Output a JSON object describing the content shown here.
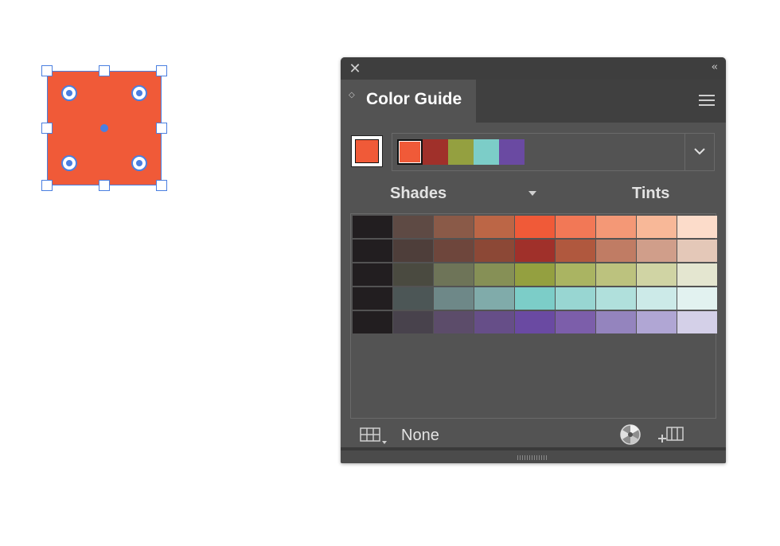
{
  "canvas": {
    "shape_fill": "#f05a38",
    "selection_color": "#4a7fe0"
  },
  "panel": {
    "title_tab": "Color Guide",
    "close_icon": "close-icon",
    "collapse_icon": "double-chevron-left-icon",
    "menu_icon": "hamburger-menu-icon",
    "base_color": "#f05a38",
    "harmony_colors": [
      "#f05a38",
      "#a0302a",
      "#94a040",
      "#7ccdc8",
      "#6a4aa2"
    ],
    "shades_label": "Shades",
    "tints_label": "Tints",
    "variation_rows": [
      [
        "#221e20",
        "#5e4a44",
        "#8a5a48",
        "#bc6646",
        "#f05a38",
        "#f27856",
        "#f49876",
        "#f8b898",
        "#fcdcca"
      ],
      [
        "#221e20",
        "#4e3e3a",
        "#6e463c",
        "#8c4836",
        "#a0302a",
        "#b0583e",
        "#c07c64",
        "#d09e8a",
        "#e4c8b8"
      ],
      [
        "#221e20",
        "#4a4a40",
        "#6e7458",
        "#869056",
        "#94a040",
        "#aab462",
        "#bcc27e",
        "#d0d4a4",
        "#e4e6d0"
      ],
      [
        "#221e20",
        "#4c5656",
        "#6e8888",
        "#80abaa",
        "#7ccdc8",
        "#98d6d2",
        "#b0e0dc",
        "#cceae8",
        "#e2f2f0"
      ],
      [
        "#221e20",
        "#48424c",
        "#5c4c6a",
        "#664e88",
        "#6a4aa2",
        "#7c5eaa",
        "#9484be",
        "#b0a6d4",
        "#d4d0e8"
      ]
    ],
    "limit_label": "None",
    "limit_icon": "swatch-library-grid-icon",
    "color_wheel_icon": "color-wheel-icon",
    "save_group_icon": "save-color-group-icon"
  }
}
